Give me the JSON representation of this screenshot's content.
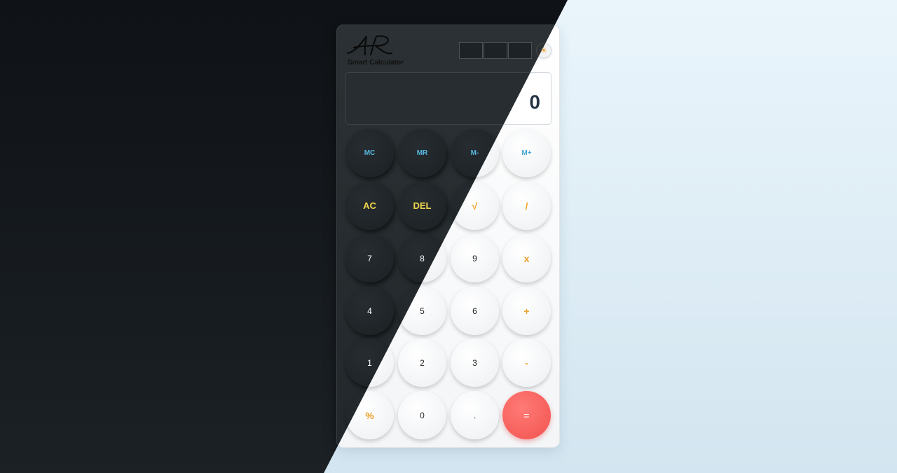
{
  "app": {
    "brand_name": "Smart Calculator",
    "logo_text": "AR"
  },
  "display": {
    "value": "0"
  },
  "memory_slots": [
    "",
    "",
    ""
  ],
  "theme_toggle": {
    "icon": "sun-icon"
  },
  "keys": {
    "mc": "MC",
    "mr": "MR",
    "m_minus": "M-",
    "m_plus": "M+",
    "ac": "AC",
    "del": "DEL",
    "sqrt": "√",
    "divide": "/",
    "seven": "7",
    "eight": "8",
    "nine": "9",
    "multiply": "x",
    "four": "4",
    "five": "5",
    "six": "6",
    "plus": "+",
    "one": "1",
    "two": "2",
    "three": "3",
    "minus": "-",
    "percent": "%",
    "zero": "0",
    "decimal": ".",
    "equals": "="
  },
  "colors": {
    "memory": "#56b9e2",
    "function": "#f1d64b",
    "operator": "#f0a12a",
    "equals": "#f2534f"
  }
}
